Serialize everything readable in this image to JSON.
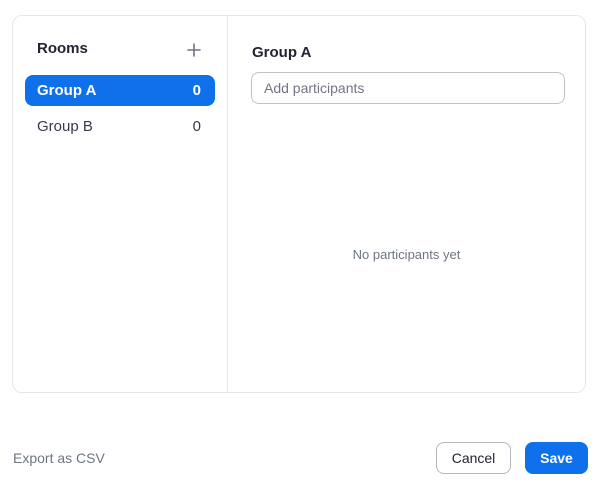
{
  "sidebar": {
    "title": "Rooms",
    "add_icon": "plus-icon",
    "rooms": [
      {
        "name": "Group A",
        "count": "0",
        "selected": true
      },
      {
        "name": "Group B",
        "count": "0",
        "selected": false
      }
    ]
  },
  "main": {
    "group_title": "Group A",
    "participant_input": {
      "placeholder": "Add participants",
      "value": ""
    },
    "empty_message": "No participants yet"
  },
  "footer": {
    "export_label": "Export as CSV",
    "cancel_label": "Cancel",
    "save_label": "Save"
  },
  "colors": {
    "accent": "#0e71eb",
    "border": "#e6e7ec",
    "muted_text": "#6e7680"
  }
}
